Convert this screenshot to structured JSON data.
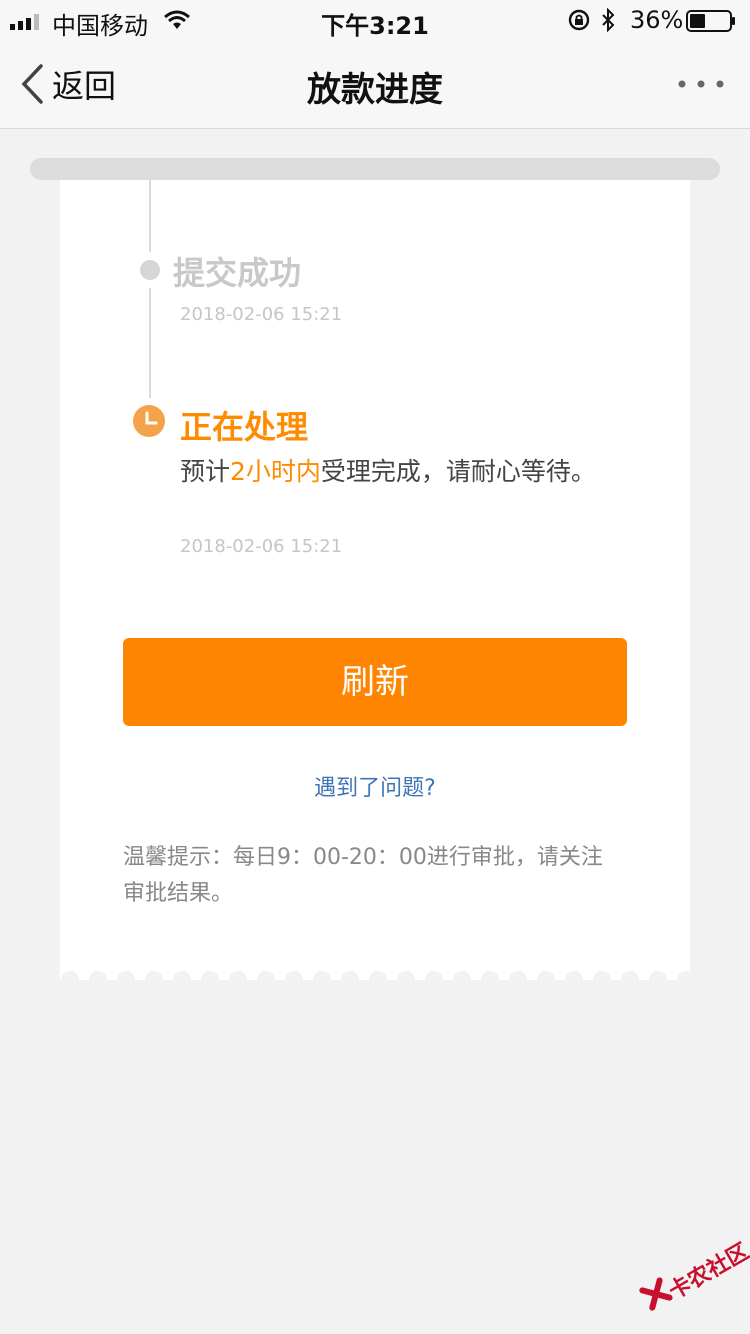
{
  "status_bar": {
    "carrier": "中国移动",
    "time": "下午3:21",
    "battery": "36%"
  },
  "nav": {
    "back_label": "返回",
    "title": "放款进度",
    "more_icon": "more-icon"
  },
  "timeline": {
    "steps": [
      {
        "title": "提交成功",
        "time": "2018-02-06 15:21",
        "status": "done"
      },
      {
        "title": "正在处理",
        "desc_prefix": "预计",
        "desc_highlight": "2小时内",
        "desc_suffix": "受理完成，请耐心等待。",
        "time": "2018-02-06 15:21",
        "status": "processing"
      }
    ]
  },
  "actions": {
    "refresh_label": "刷新",
    "problem_link": "遇到了问题?"
  },
  "tip": "温馨提示：每日9：00-20：00进行审批，请关注审批结果。",
  "watermark": "卡农社区",
  "colors": {
    "accent": "#ff8500",
    "link": "#3d75b8",
    "muted": "#c6c6c6"
  }
}
